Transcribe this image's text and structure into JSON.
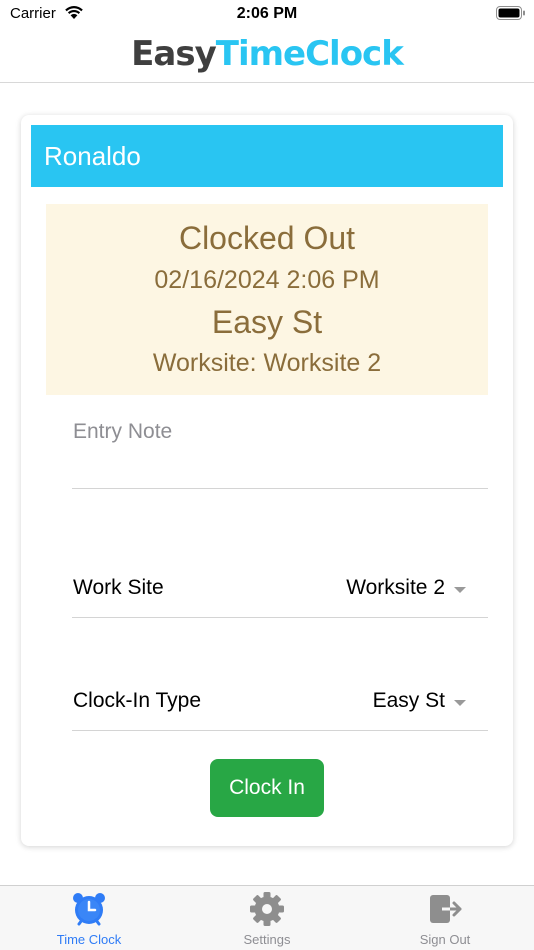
{
  "status_bar": {
    "carrier": "Carrier",
    "time": "2:06 PM"
  },
  "header": {
    "logo_part1": "Easy",
    "logo_part2": "TimeClock"
  },
  "card": {
    "employee_name": "Ronaldo",
    "status": {
      "title": "Clocked Out",
      "datetime": "02/16/2024 2:06 PM",
      "place": "Easy St",
      "worksite": "Worksite: Worksite 2"
    },
    "entry_note": {
      "value": "",
      "placeholder": "Entry Note"
    },
    "work_site": {
      "label": "Work Site",
      "selected": "Worksite 2"
    },
    "clock_in_type": {
      "label": "Clock-In Type",
      "selected": "Easy St"
    },
    "clock_in_button": "Clock In"
  },
  "tab_bar": {
    "tabs": [
      {
        "label": "Time Clock",
        "icon": "alarm-clock-icon",
        "active": true
      },
      {
        "label": "Settings",
        "icon": "gear-icon",
        "active": false
      },
      {
        "label": "Sign Out",
        "icon": "sign-out-icon",
        "active": false
      }
    ]
  },
  "colors": {
    "accent": "#29c5f2",
    "status_bg": "#fdf6e3",
    "status_text": "#8a6d3b",
    "button_green": "#28a745",
    "tab_active": "#2f7cf6",
    "tab_inactive": "#8e8e93"
  }
}
